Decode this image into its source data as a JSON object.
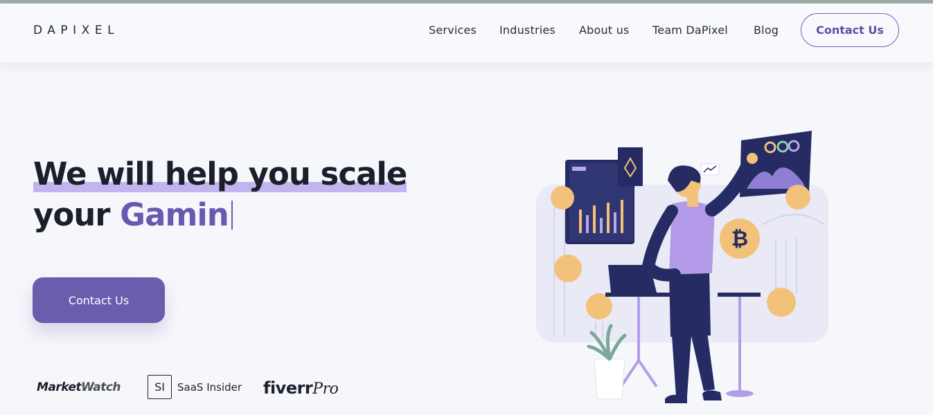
{
  "brand": {
    "logo": "DAPIXEL"
  },
  "nav": {
    "links": [
      "Services",
      "Industries",
      "About us",
      "Team DaPixel",
      "Blog"
    ],
    "contact": "Contact Us"
  },
  "hero": {
    "line1": "We will help you scale",
    "line2_prefix": "your ",
    "line2_accent": "Gamin",
    "cta": "Contact Us"
  },
  "partners": {
    "marketwatch_a": "Market",
    "marketwatch_b": "Watch",
    "saas_box": "SI",
    "saas_name": "SaaS Insider",
    "fiverr": "fiverr",
    "fiverr_pro": "Pro"
  },
  "colors": {
    "accent": "#6c5cae",
    "highlight": "#b9a9ec",
    "navy": "#262b63",
    "coin": "#f2c27a"
  }
}
